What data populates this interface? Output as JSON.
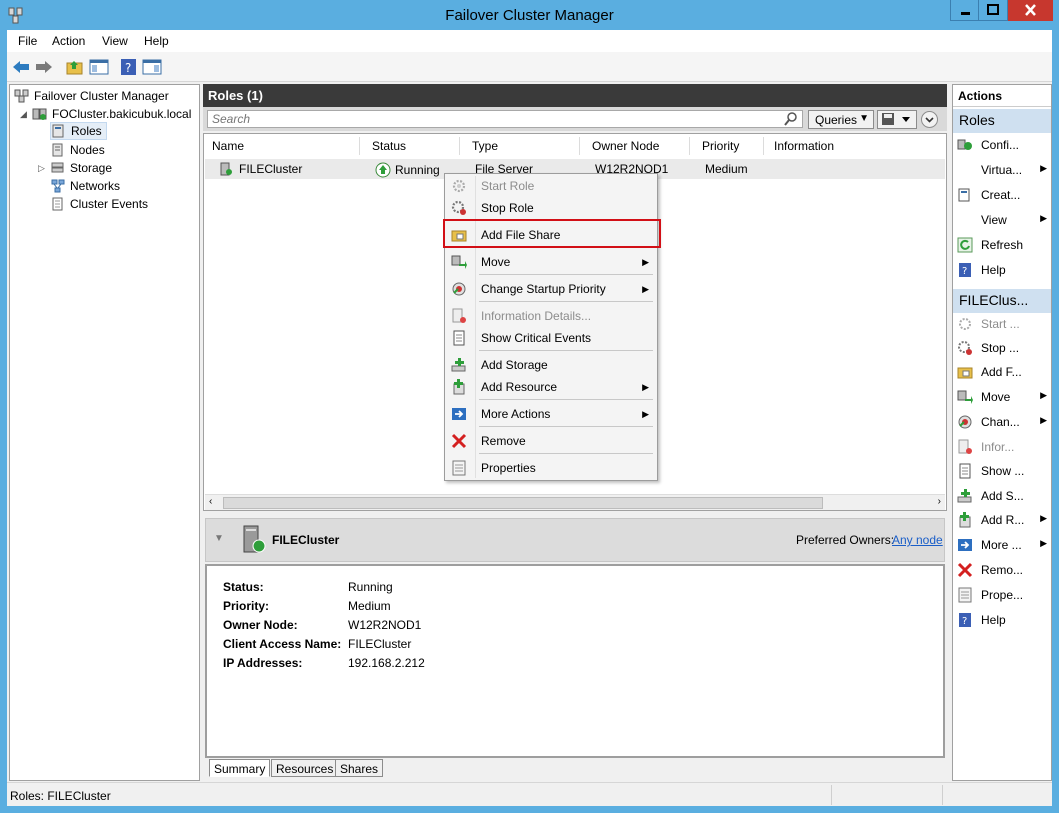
{
  "window": {
    "title": "Failover Cluster Manager"
  },
  "menubar": {
    "items": [
      "File",
      "Action",
      "View",
      "Help"
    ]
  },
  "tree": {
    "root": "Failover Cluster Manager",
    "cluster": "FOCluster.bakicubuk.local",
    "items": [
      "Roles",
      "Nodes",
      "Storage",
      "Networks",
      "Cluster Events"
    ],
    "selected": "Roles"
  },
  "roles": {
    "header": "Roles (1)",
    "search_placeholder": "Search",
    "queries_label": "Queries",
    "columns": [
      "Name",
      "Status",
      "Type",
      "Owner Node",
      "Priority",
      "Information"
    ],
    "rows": [
      {
        "name": "FILECluster",
        "status": "Running",
        "type": "File Server",
        "owner": "W12R2NOD1",
        "priority": "Medium",
        "information": ""
      }
    ]
  },
  "context_menu": {
    "items": [
      {
        "label": "Start Role",
        "disabled": true,
        "submenu": false,
        "icon": "gear-start-icon"
      },
      {
        "label": "Stop Role",
        "disabled": false,
        "submenu": false,
        "icon": "gear-stop-icon"
      },
      {
        "label": "Add File Share",
        "disabled": false,
        "submenu": false,
        "icon": "folder-share-icon"
      },
      {
        "label": "Move",
        "disabled": false,
        "submenu": true,
        "icon": "move-icon"
      },
      {
        "label": "Change Startup Priority",
        "disabled": false,
        "submenu": true,
        "icon": "priority-icon"
      },
      {
        "label": "Information Details...",
        "disabled": true,
        "submenu": false,
        "icon": "info-details-icon"
      },
      {
        "label": "Show Critical Events",
        "disabled": false,
        "submenu": false,
        "icon": "critical-events-icon"
      },
      {
        "label": "Add Storage",
        "disabled": false,
        "submenu": false,
        "icon": "add-storage-icon"
      },
      {
        "label": "Add Resource",
        "disabled": false,
        "submenu": true,
        "icon": "add-resource-icon"
      },
      {
        "label": "More Actions",
        "disabled": false,
        "submenu": true,
        "icon": "more-actions-icon"
      },
      {
        "label": "Remove",
        "disabled": false,
        "submenu": false,
        "icon": "remove-icon"
      },
      {
        "label": "Properties",
        "disabled": false,
        "submenu": false,
        "icon": "properties-icon"
      }
    ],
    "highlighted": "Add File Share"
  },
  "details": {
    "title": "FILECluster",
    "preferred_owners_label": "Preferred Owners:",
    "preferred_owners_link": "Any node",
    "fields": [
      {
        "key": "Status:",
        "value": "Running"
      },
      {
        "key": "Priority:",
        "value": "Medium"
      },
      {
        "key": "Owner Node:",
        "value": "W12R2NOD1"
      },
      {
        "key": "Client Access Name:",
        "value": "FILECluster"
      },
      {
        "key": "IP Addresses:",
        "value": "192.168.2.212"
      }
    ],
    "tabs": [
      "Summary",
      "Resources",
      "Shares"
    ]
  },
  "actions": {
    "title": "Actions",
    "section1": "Roles",
    "section1_items": [
      "Confi...",
      "Virtua...",
      "Creat...",
      "View",
      "Refresh",
      "Help"
    ],
    "section2": "FILEClus...",
    "section2_items": [
      "Start ...",
      "Stop ...",
      "Add F...",
      "Move",
      "Chan...",
      "Infor...",
      "Show ...",
      "Add S...",
      "Add R...",
      "More ...",
      "Remo...",
      "Prope...",
      "Help"
    ]
  },
  "statusbar": {
    "text": "Roles:  FILECluster"
  },
  "colors": {
    "titlebar": "#5aaee0",
    "close": "#c7372e",
    "highlight": "#d20f16",
    "section": "#cfe0f0"
  }
}
